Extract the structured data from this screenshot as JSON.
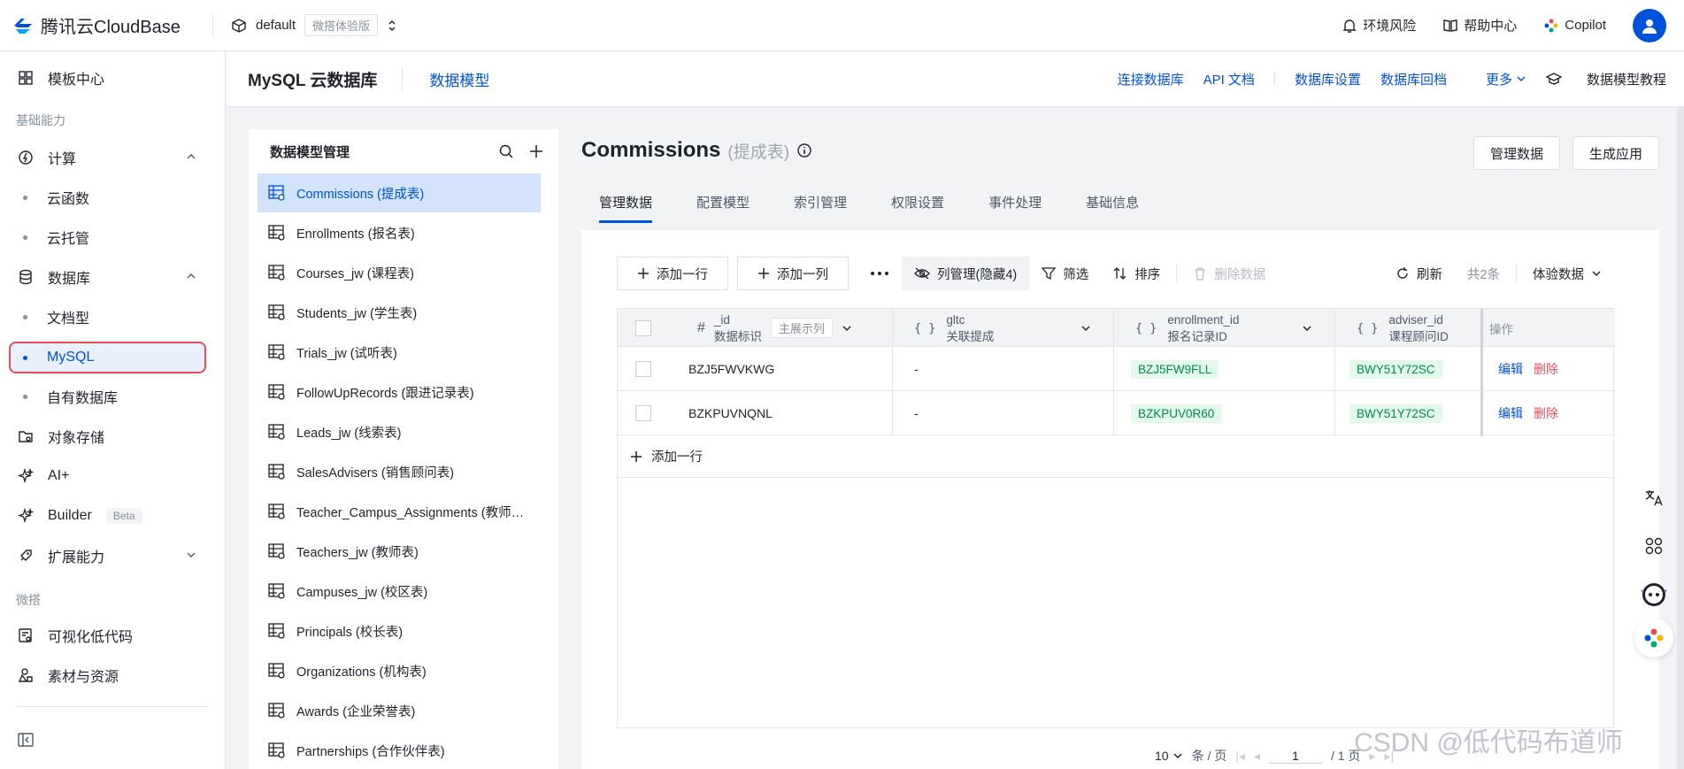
{
  "topbar": {
    "brand": "腾讯云CloudBase",
    "env_name": "default",
    "env_badge": "微搭体验版",
    "items": [
      "环境风险",
      "帮助中心",
      "Copilot"
    ]
  },
  "sidebar": {
    "template_center": "模板中心",
    "group_basic": "基础能力",
    "compute": "计算",
    "cloud_function": "云函数",
    "cloud_hosting": "云托管",
    "database": "数据库",
    "doc_db": "文档型",
    "mysql": "MySQL",
    "own_db": "自有数据库",
    "object_storage": "对象存储",
    "ai": "AI+",
    "builder": "Builder",
    "builder_badge": "Beta",
    "extensions": "扩展能力",
    "group_weda": "微搭",
    "lowcode": "可视化低代码",
    "assets": "素材与资源"
  },
  "subheader": {
    "title": "MySQL 云数据库",
    "tab": "数据模型",
    "links": [
      "连接数据库",
      "API 文档",
      "数据库设置",
      "数据库回档",
      "更多"
    ],
    "tutorial": "数据模型教程"
  },
  "model_panel": {
    "title": "数据模型管理",
    "items": [
      "Commissions (提成表)",
      "Enrollments (报名表)",
      "Courses_jw (课程表)",
      "Students_jw (学生表)",
      "Trials_jw (试听表)",
      "FollowUpRecords (跟进记录表)",
      "Leads_jw (线索表)",
      "SalesAdvisers (销售顾问表)",
      "Teacher_Campus_Assignments (教师…",
      "Teachers_jw (教师表)",
      "Campuses_jw (校区表)",
      "Principals (校长表)",
      "Organizations (机构表)",
      "Awards (企业荣誉表)",
      "Partnerships (合作伙伴表)"
    ]
  },
  "content": {
    "title": "Commissions",
    "subtitle": "(提成表)",
    "btn_manage": "管理数据",
    "btn_generate": "生成应用",
    "tabs": [
      "管理数据",
      "配置模型",
      "索引管理",
      "权限设置",
      "事件处理",
      "基础信息"
    ],
    "toolbar": {
      "add_row": "添加一行",
      "add_col": "添加一列",
      "col_manage": "列管理(隐藏4)",
      "filter": "筛选",
      "sort": "排序",
      "delete": "删除数据",
      "refresh": "刷新",
      "total": "共2条",
      "data_env": "体验数据"
    },
    "columns": {
      "id_name": "_id",
      "id_label": "数据标识",
      "id_hint": "主展示列",
      "gltc_name": "gltc",
      "gltc_label": "关联提成",
      "enroll_name": "enrollment_id",
      "enroll_label": "报名记录ID",
      "adviser_name": "adviser_id",
      "adviser_label": "课程顾问ID",
      "ops": "操作"
    },
    "rows": [
      {
        "id": "BZJ5FWVKWG",
        "gltc": "-",
        "enrollment": "BZJ5FW9FLL",
        "adviser": "BWY51Y72SC",
        "edit": "编辑",
        "delete": "删除"
      },
      {
        "id": "BZKPUVNQNL",
        "gltc": "-",
        "enrollment": "BZKPUV0R60",
        "adviser": "BWY51Y72SC",
        "edit": "编辑",
        "delete": "删除"
      }
    ],
    "add_row_bottom": "添加一行",
    "pager": {
      "size": "10",
      "unit": "条 / 页",
      "page": "1",
      "pages": "/ 1 页"
    }
  },
  "watermark": "CSDN @低代码布道师",
  "colors": {
    "primary": "#0052d9",
    "danger": "#e34d59",
    "success": "#008858"
  }
}
